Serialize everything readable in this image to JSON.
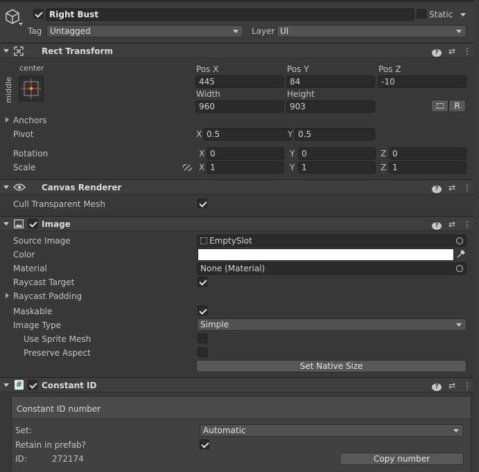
{
  "object": {
    "name": "Right Bust",
    "active": true,
    "static_label": "Static",
    "tag_label": "Tag",
    "tag_value": "Untagged",
    "layer_label": "Layer",
    "layer_value": "UI"
  },
  "rect_transform": {
    "title": "Rect Transform",
    "anchor_top": "center",
    "anchor_side": "middle",
    "pos_x_label": "Pos X",
    "pos_x": "445",
    "pos_y_label": "Pos Y",
    "pos_y": "84",
    "pos_z_label": "Pos Z",
    "pos_z": "-10",
    "width_label": "Width",
    "width": "960",
    "height_label": "Height",
    "height": "903",
    "r_label": "R",
    "anchors_label": "Anchors",
    "pivot_label": "Pivot",
    "pivot_x_label": "X",
    "pivot_x": "0.5",
    "pivot_y_label": "Y",
    "pivot_y": "0.5",
    "rotation_label": "Rotation",
    "rot_x": "0",
    "rot_y": "0",
    "rot_z": "0",
    "scale_label": "Scale",
    "scale_x": "1",
    "scale_y": "1",
    "scale_z": "1",
    "x": "X",
    "y": "Y",
    "z": "Z"
  },
  "canvas_renderer": {
    "title": "Canvas Renderer",
    "cull_label": "Cull Transparent Mesh",
    "cull": true
  },
  "image": {
    "title": "Image",
    "enabled": true,
    "source_label": "Source Image",
    "source_value": "EmptySlot",
    "color_label": "Color",
    "color_value": "#ffffff",
    "material_label": "Material",
    "material_value": "None (Material)",
    "raycast_target_label": "Raycast Target",
    "raycast_target": true,
    "raycast_padding_label": "Raycast Padding",
    "maskable_label": "Maskable",
    "maskable": true,
    "image_type_label": "Image Type",
    "image_type": "Simple",
    "use_sprite_mesh_label": "Use Sprite Mesh",
    "use_sprite_mesh": false,
    "preserve_aspect_label": "Preserve Aspect",
    "preserve_aspect": false,
    "native_size_button": "Set Native Size"
  },
  "constant_id": {
    "title": "Constant ID",
    "enabled": true,
    "box_title": "Constant ID number",
    "set_label": "Set:",
    "set_value": "Automatic",
    "retain_label": "Retain in prefab?",
    "retain": true,
    "id_label": "ID:",
    "id_value": "272174",
    "copy_button": "Copy number"
  },
  "colors": {
    "bg": "#383838",
    "header": "#3e3e3e",
    "field": "#2a2a2a",
    "anchor_orange": "#e0832a"
  }
}
